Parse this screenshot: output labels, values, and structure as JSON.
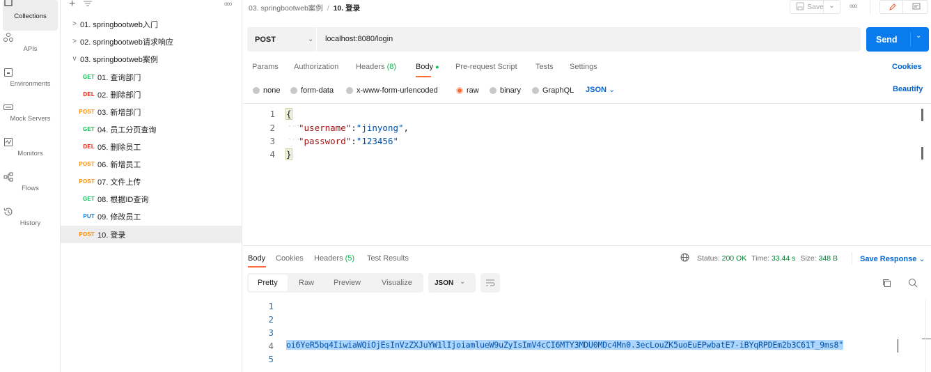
{
  "rail": [
    {
      "label": "Collections",
      "icon": "collections-icon",
      "active": true
    },
    {
      "label": "APIs",
      "icon": "apis-icon"
    },
    {
      "label": "Environments",
      "icon": "environments-icon"
    },
    {
      "label": "Mock Servers",
      "icon": "mock-servers-icon"
    },
    {
      "label": "Monitors",
      "icon": "monitors-icon"
    },
    {
      "label": "Flows",
      "icon": "flows-icon"
    },
    {
      "label": "History",
      "icon": "history-icon"
    }
  ],
  "tree": {
    "more_label": "ooo",
    "folders": [
      {
        "label": "01. springbootweb入门",
        "chevron": ">"
      },
      {
        "label": "02. springbootweb请求响应",
        "chevron": ">"
      },
      {
        "label": "03. springbootweb案例",
        "chevron": "v"
      }
    ],
    "requests": [
      {
        "method": "GET",
        "label": "01. 查询部门"
      },
      {
        "method": "DEL",
        "label": "02. 删除部门"
      },
      {
        "method": "POST",
        "label": "03. 新增部门"
      },
      {
        "method": "GET",
        "label": "04. 员工分页查询"
      },
      {
        "method": "DEL",
        "label": "05. 删除员工"
      },
      {
        "method": "POST",
        "label": "06. 新增员工"
      },
      {
        "method": "POST",
        "label": "07. 文件上传"
      },
      {
        "method": "GET",
        "label": "08. 根据ID查询"
      },
      {
        "method": "PUT",
        "label": "09. 修改员工"
      },
      {
        "method": "POST",
        "label": "10. 登录",
        "selected": true
      }
    ]
  },
  "header": {
    "breadcrumb_parent": "03. springbootweb案例",
    "breadcrumb_sep": "/",
    "breadcrumb_current": "10. 登录",
    "save_label": "Save",
    "more_label": "ooo"
  },
  "request": {
    "method": "POST",
    "url": "localhost:8080/login",
    "send_label": "Send"
  },
  "req_tabs": {
    "params": "Params",
    "authorization": "Authorization",
    "headers_label": "Headers",
    "headers_count": "(8)",
    "body": "Body",
    "prerequest": "Pre-request Script",
    "tests": "Tests",
    "settings": "Settings",
    "cookies": "Cookies"
  },
  "body_types": {
    "none": "none",
    "form_data": "form-data",
    "urlencoded": "x-www-form-urlencoded",
    "raw": "raw",
    "binary": "binary",
    "graphql": "GraphQL",
    "format": "JSON",
    "beautify": "Beautify"
  },
  "request_body": [
    {
      "n": "1",
      "text": "{"
    },
    {
      "n": "2",
      "key": "\"username\"",
      "colon": ":",
      "value": "\"jinyong\"",
      "comma": ","
    },
    {
      "n": "3",
      "key": "\"password\"",
      "colon": ":",
      "value": "\"123456\"",
      "comma": ""
    },
    {
      "n": "4",
      "text": "}"
    }
  ],
  "resp_tabs": {
    "body": "Body",
    "cookies": "Cookies",
    "headers_label": "Headers",
    "headers_count": "(5)",
    "test_results": "Test Results"
  },
  "resp_status": {
    "status_label": "Status:",
    "status_value": "200 OK",
    "time_label": "Time:",
    "time_value": "33.44 s",
    "size_label": "Size:",
    "size_value": "348 B",
    "save_response": "Save Response"
  },
  "resp_view": {
    "pretty": "Pretty",
    "raw": "Raw",
    "preview": "Preview",
    "visualize": "Visualize",
    "format": "JSON"
  },
  "response_body": {
    "line_numbers": [
      "1",
      "2",
      "3",
      "4",
      "5"
    ],
    "line4_text": "oi6YeR5bq4IiwiaWQiOjEsInVzZXJuYW1lIjoiamlueW9uZyIsImV4cCI6MTY3MDU0MDc4Mn0.3ecLouZK5uoEuEPwbatE7-iBYqRPDEm2b3C61T_9ms8\""
  },
  "colors": {
    "accent": "#ff6c37",
    "send_button": "#097bed",
    "link_blue": "#0265d2",
    "status_green": "#007f31",
    "json_key": "#a31515",
    "json_value": "#0451a5",
    "selection": "#add6ff"
  }
}
